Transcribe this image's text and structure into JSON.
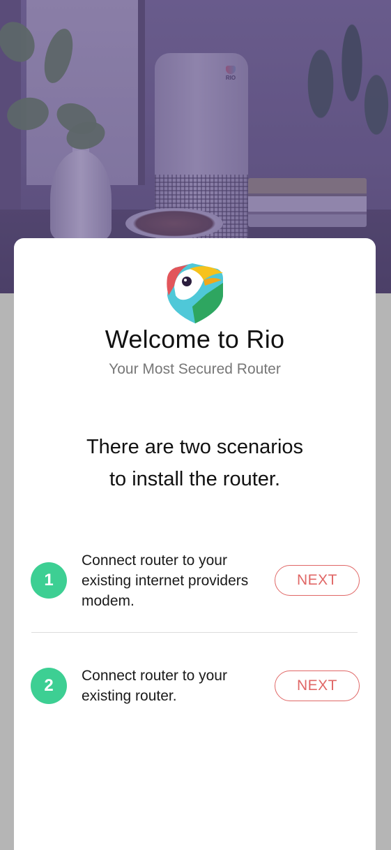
{
  "welcome": {
    "title": "Welcome to Rio",
    "subtitle": "Your Most Secured Router",
    "intro_line1": "There are two scenarios",
    "intro_line2": "to install the router."
  },
  "hero": {
    "router_brand": "RIO"
  },
  "scenarios": [
    {
      "number": "1",
      "description": "Connect router to your existing internet providers modem.",
      "button_label": "NEXT"
    },
    {
      "number": "2",
      "description": "Connect router to your existing router.",
      "button_label": "NEXT"
    }
  ],
  "colors": {
    "accent_green": "#3dcf93",
    "button_red": "#e06766",
    "background_gray": "#b5b5b5"
  }
}
